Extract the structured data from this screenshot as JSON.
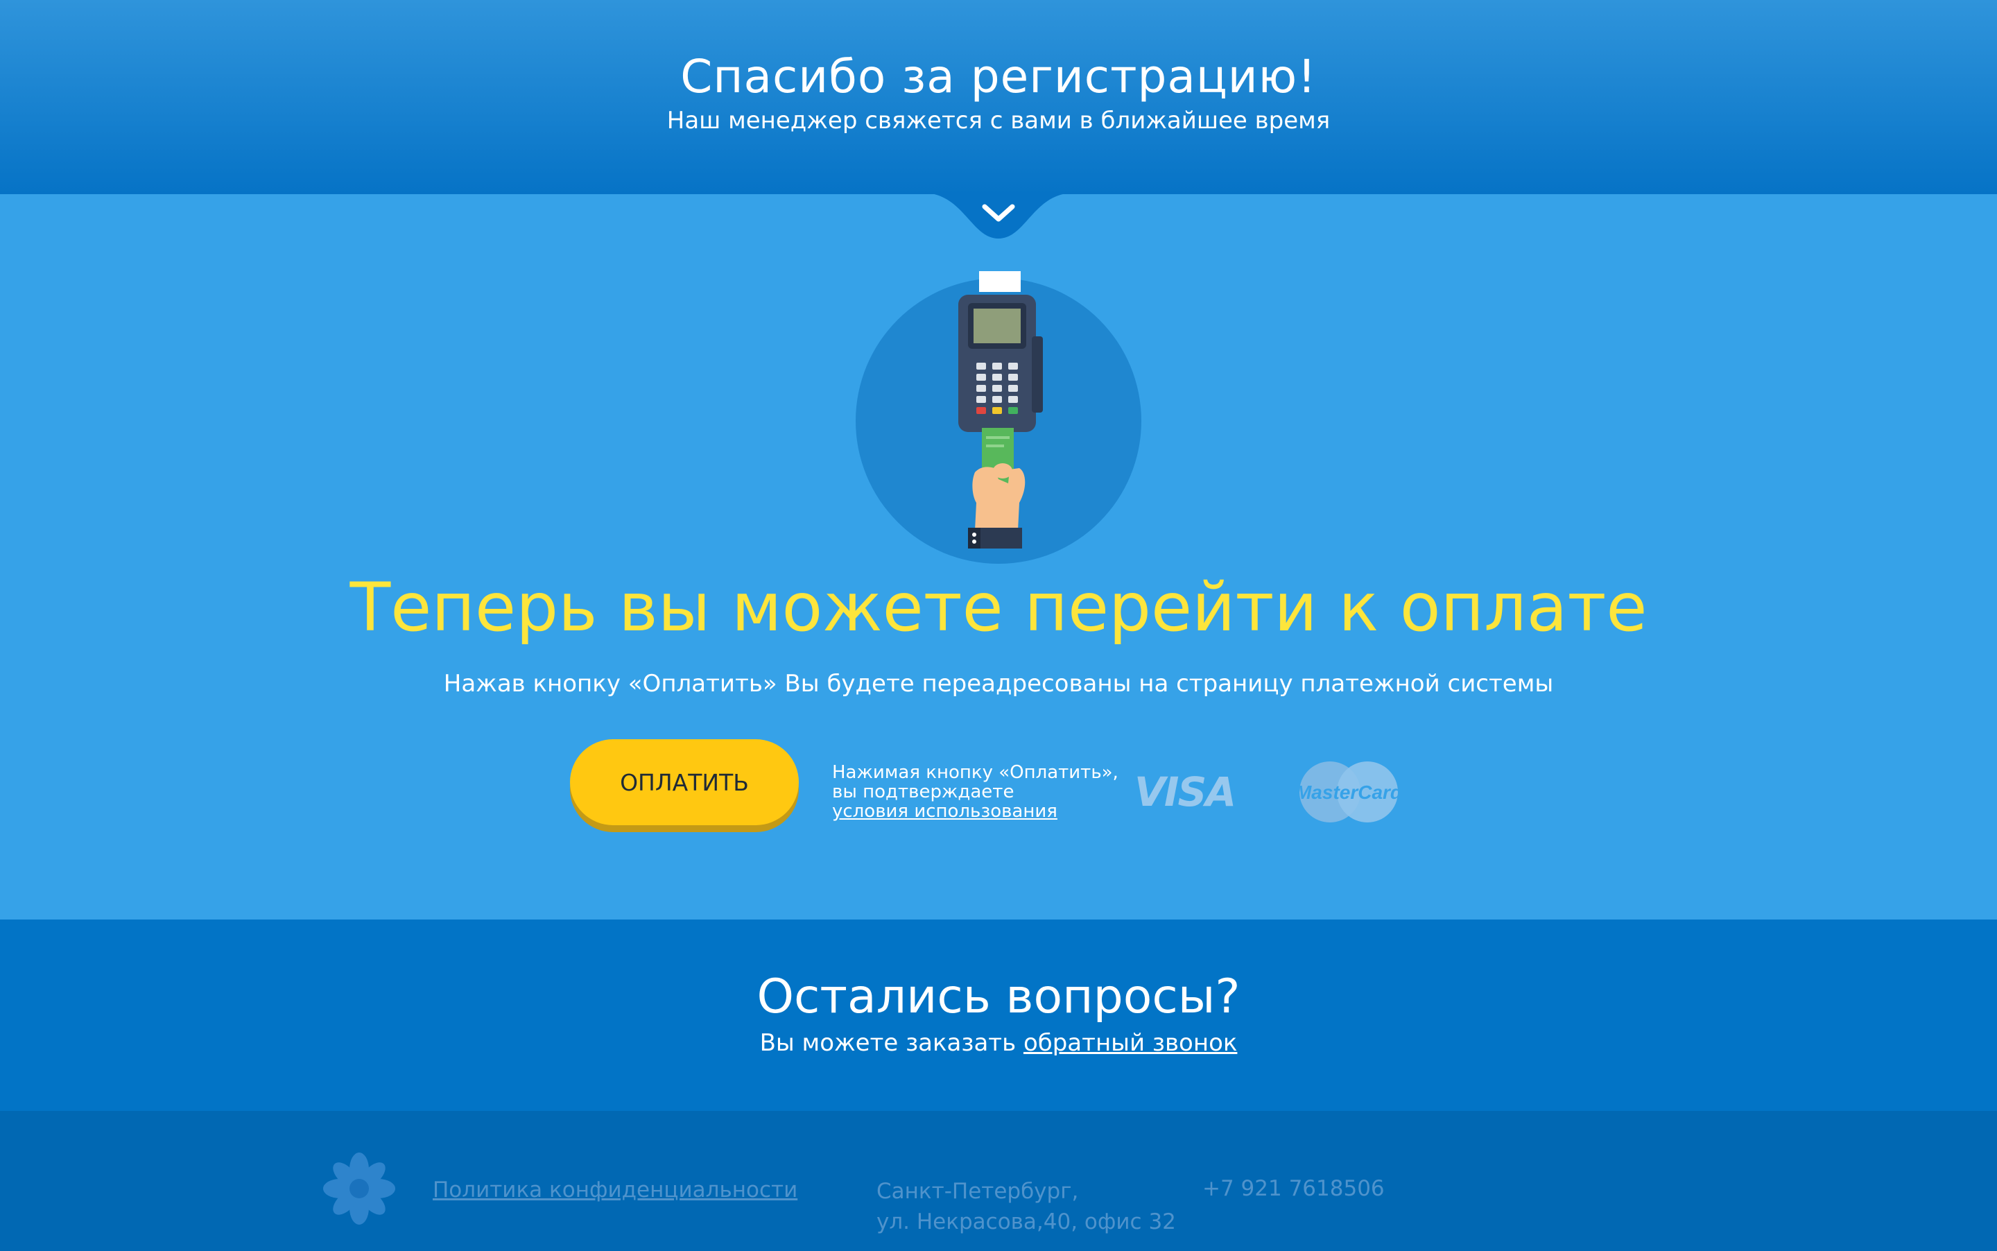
{
  "header": {
    "title": "Спасибо за регистрацию!",
    "subtitle": "Наш менеджер свяжется с вами в ближайшее время"
  },
  "payment": {
    "title": "Теперь вы можете перейти к оплате",
    "subtitle": "Нажав кнопку «Оплатить» Вы будете переадресованы на страницу платежной системы",
    "button_label": "ОПЛАТИТЬ",
    "agree_line1": "Нажимая кнопку «Оплатить»,",
    "agree_line2": "вы подтверждаете",
    "agree_link": "условия использования",
    "visa_label": "VISA",
    "mastercard_label": "MasterCard"
  },
  "questions": {
    "title": "Остались вопросы?",
    "text": "Вы можете заказать",
    "link": "обратный звонок"
  },
  "footer": {
    "privacy_link": "Политика конфиденциальности",
    "address_line1": "Санкт-Петербург,",
    "address_line2": "ул. Некрасова,40, офис 32",
    "phone": "+7 921 7618506"
  },
  "colors": {
    "accent_yellow": "#fde53c",
    "button_yellow": "#ffc811",
    "main_blue": "#36a2e8",
    "dark_blue": "#0274c6"
  }
}
